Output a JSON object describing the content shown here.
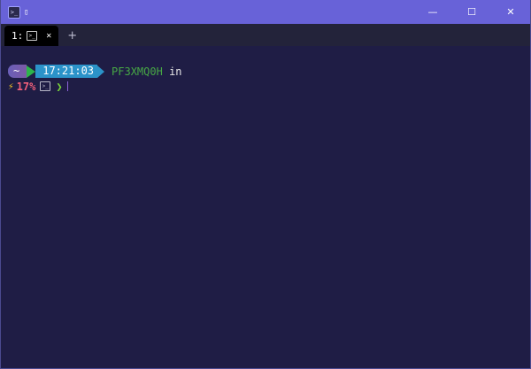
{
  "window": {
    "title": "▯",
    "controls": {
      "minimize": "—",
      "maximize": "☐",
      "close": "✕"
    }
  },
  "tabs": [
    {
      "label": "1:",
      "icon": "terminal-icon"
    }
  ],
  "new_tab_label": "+",
  "prompt": {
    "home": "~",
    "time": "17:21:03",
    "host": "PF3XMQ0H",
    "in_word": "in",
    "battery_icon": "⚡",
    "battery": "17%",
    "chevron": "❯"
  },
  "colors": {
    "titlebar": "#6862d8",
    "terminal_bg": "#1f1d45",
    "time_segment": "#2b93c9",
    "host": "#47a845",
    "battery": "#f25f7a",
    "bolt": "#f3c623",
    "prompt_chevron": "#7ad53a"
  }
}
